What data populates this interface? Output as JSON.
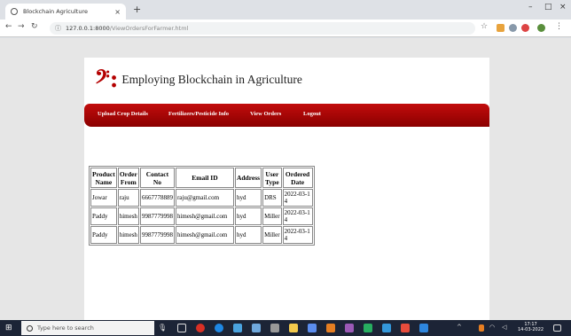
{
  "browser": {
    "tab_title": "Blockchain Agriculture",
    "tab_close": "×",
    "new_tab": "+",
    "url_host": "127.0.0.1:8000",
    "url_path": "/ViewOrdersForFarmer.html",
    "window_controls": [
      "–",
      "□",
      "×"
    ]
  },
  "site": {
    "logo_glyph": "𝄢:",
    "title": "Employing Blockchain in Agriculture",
    "menu": [
      "Upload Crop Details",
      "Fertilizers/Pesticide Info",
      "View Orders",
      "Logout"
    ]
  },
  "orders": {
    "columns": [
      [
        "Product",
        "Name"
      ],
      [
        "Order",
        "From"
      ],
      [
        "Contact",
        "No"
      ],
      [
        "Email ID"
      ],
      [
        "Address"
      ],
      [
        "User",
        "Type"
      ],
      [
        "Ordered",
        "Date"
      ]
    ],
    "rows": [
      [
        "Jowar",
        "raju",
        "6667778889",
        "raju@gmail.com",
        "hyd",
        "DRS",
        "2022-03-14"
      ],
      [
        "Paddy",
        "himesh",
        "9987779998",
        "himesh@gmail.com",
        "hyd",
        "Miller",
        "2022-03-14"
      ],
      [
        "Paddy",
        "himesh",
        "9987779998",
        "himesh@gmail.com",
        "hyd",
        "Miller",
        "2022-03-14"
      ]
    ]
  },
  "taskbar": {
    "search_placeholder": "Type here to search",
    "time": "17:17",
    "date": "14-03-2022"
  },
  "colors": {
    "menu_red": "#b00000",
    "taskbar": "#1c2436"
  }
}
